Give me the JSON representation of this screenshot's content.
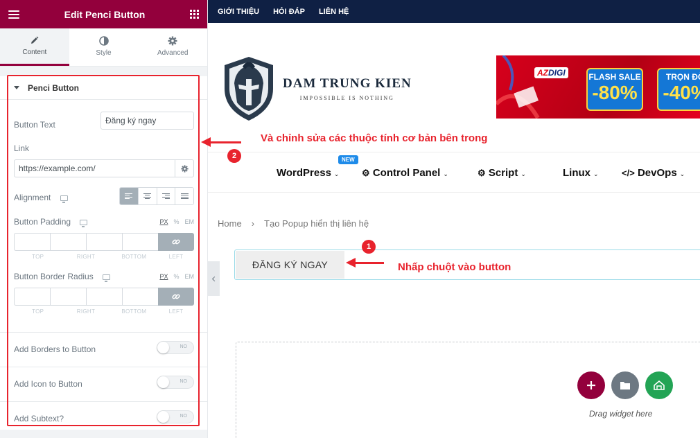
{
  "panel": {
    "title": "Edit Penci Button",
    "tabs": [
      {
        "label": "Content",
        "icon": "pencil-icon"
      },
      {
        "label": "Style",
        "icon": "contrast-icon"
      },
      {
        "label": "Advanced",
        "icon": "gear-icon"
      }
    ],
    "section_title": "Penci Button",
    "button_text_label": "Button Text",
    "button_text_value": "Đăng ký ngay",
    "link_label": "Link",
    "link_value": "https://example.com/",
    "alignment_label": "Alignment",
    "padding_label": "Button Padding",
    "radius_label": "Button Border Radius",
    "units": [
      "PX",
      "%",
      "EM"
    ],
    "dim_labels": [
      "TOP",
      "RIGHT",
      "BOTTOM",
      "LEFT"
    ],
    "toggles": [
      {
        "label": "Add Borders to Button",
        "state": "NO"
      },
      {
        "label": "Add Icon to Button",
        "state": "NO"
      },
      {
        "label": "Add Subtext?",
        "state": "NO"
      }
    ],
    "accent_color": "#93003c"
  },
  "site": {
    "topbar": [
      "GIỚI THIỆU",
      "HỎI ĐÁP",
      "LIÊN HỆ"
    ],
    "brand_name": "DAM TRUNG KIEN",
    "brand_tagline": "IMPOSSIBLE IS NOTHING",
    "banner": {
      "brand_a": "AZ",
      "brand_b": "DIGI",
      "sale1_title": "FLASH SALE",
      "sale1_value": "-80%",
      "sale2_title": "TRỌN ĐỜ",
      "sale2_value": "-40%"
    },
    "nav": [
      {
        "label": "WordPress",
        "icon": ""
      },
      {
        "label": "Control Panel",
        "icon": "gears-icon"
      },
      {
        "label": "Script",
        "icon": "gear-icon"
      },
      {
        "label": "Linux",
        "icon": ""
      },
      {
        "label": "DevOps",
        "icon": "code-icon"
      }
    ],
    "new_badge": "NEW",
    "breadcrumb": [
      "Home",
      "›",
      "Tạo Popup hiển thị liên hệ"
    ],
    "button_label": "ĐĂNG KÝ NGAY",
    "drag_text": "Drag widget here"
  },
  "annotations": {
    "step1_number": "1",
    "step1_text": "Nhấp chuột vào button",
    "step2_number": "2",
    "step2_text": "Và chỉnh sửa các thuộc tính cơ bản bên trong"
  }
}
